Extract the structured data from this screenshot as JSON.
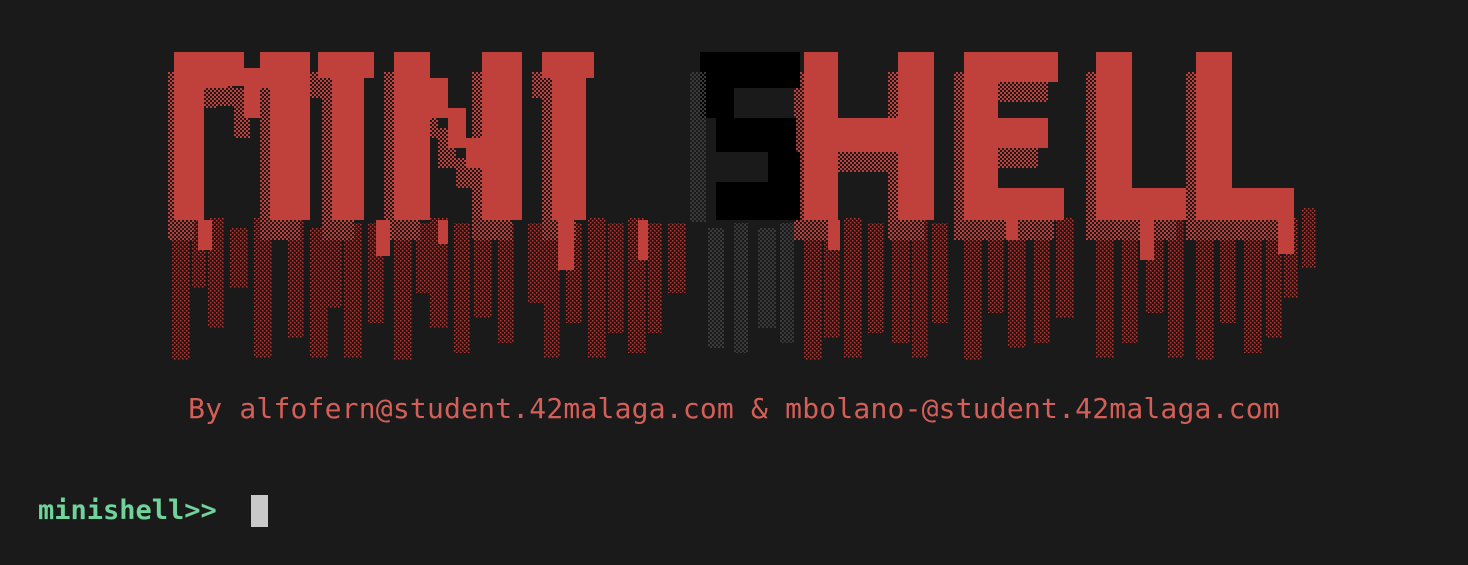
{
  "banner": {
    "text": "MINISHELL"
  },
  "byline": {
    "text": "By alfofern@student.42malaga.com & mbolano-@student.42malaga.com"
  },
  "prompt": {
    "text": "minishell>>"
  },
  "colors": {
    "background": "#1a1a1a",
    "banner_red": "#c0403b",
    "banner_black": "#000000",
    "byline": "#d45f58",
    "prompt": "#6fd39b",
    "cursor": "#c9c9c9"
  }
}
